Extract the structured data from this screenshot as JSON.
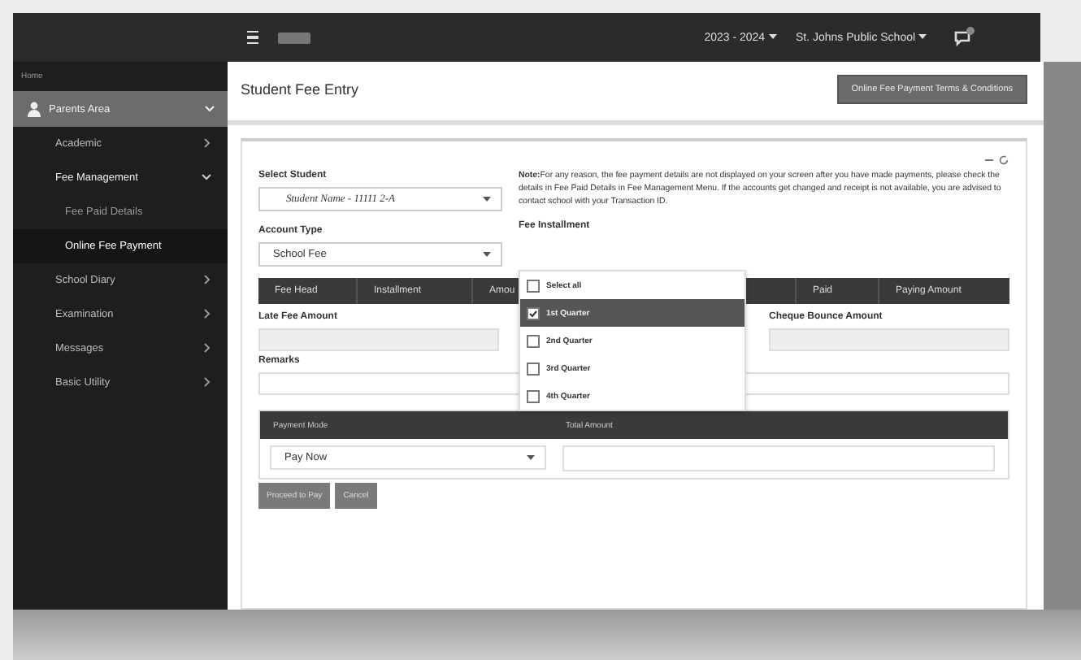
{
  "header": {
    "session": "2023 - 2024",
    "school": "St. Johns Public School"
  },
  "sidebar": {
    "home": "Home",
    "section": "Parents Area",
    "items": [
      {
        "label": "Academic",
        "expanded": false
      },
      {
        "label": "Fee Management",
        "expanded": true,
        "children": [
          {
            "label": "Fee Paid Details",
            "selected": false
          },
          {
            "label": "Online Fee Payment",
            "selected": true
          }
        ]
      },
      {
        "label": "School Diary",
        "expanded": false
      },
      {
        "label": "Examination",
        "expanded": false
      },
      {
        "label": "Messages",
        "expanded": false
      },
      {
        "label": "Basic Utility",
        "expanded": false
      }
    ]
  },
  "page": {
    "title": "Student Fee Entry",
    "terms_button": "Online Fee Payment Terms & Conditions"
  },
  "form": {
    "student_label": "Select Student",
    "student_value": "Student Name - 11111 2-A",
    "note": "**Note:**For any reason, the fee payment details are not displayed on your screen after you have made payments, please check the details in Fee Paid Details in Fee Management Menu. If the accounts get changed and receipt is not available, you are advised to contact school with your Transaction ID.",
    "account_label": "Account Type",
    "account_value": "School Fee",
    "installment_label": "Fee Installment",
    "installment_options": [
      {
        "label": "Select all",
        "checked": false,
        "selected": false
      },
      {
        "label": "1st Quarter",
        "checked": true,
        "selected": true
      },
      {
        "label": "2nd Quarter",
        "checked": false,
        "selected": false
      },
      {
        "label": "3rd Quarter",
        "checked": false,
        "selected": false
      },
      {
        "label": "4th Quarter",
        "checked": false,
        "selected": false
      }
    ],
    "fee_columns": [
      "Fee Head",
      "Installment",
      "Amou",
      "Paid",
      "Paying Amount"
    ],
    "late_fee_label": "Late Fee Amount",
    "cheque_label": "Cheque Bounce Amount",
    "remarks_label": "Remarks",
    "payment_columns": [
      "Payment Mode",
      "Total Amount"
    ],
    "payment_mode": "Pay Now",
    "buttons": [
      "Proceed to Pay",
      "Cancel"
    ]
  }
}
